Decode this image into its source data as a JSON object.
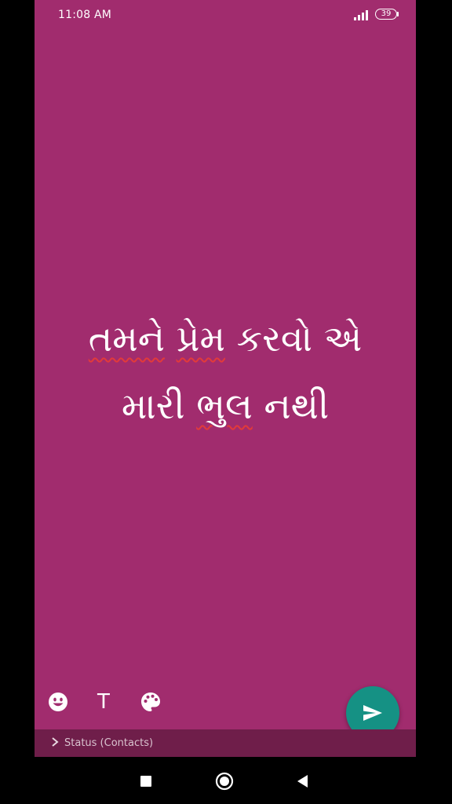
{
  "status_bar": {
    "time": "11:08 AM",
    "battery": "39",
    "icons": [
      "signal-icon",
      "battery-icon"
    ]
  },
  "status_text": {
    "line1_word1": "તમને",
    "line1_word2": "પ્રેમ",
    "line1_word3": "કરવો એ",
    "line2_word1": "મારી",
    "line2_word2": "ભુલ",
    "line2_word3": "નથી"
  },
  "tools": {
    "text_tool_label": "T",
    "icons": [
      "emoji-icon",
      "palette-icon"
    ]
  },
  "send_button": {
    "icon": "send-icon"
  },
  "audience": {
    "label": "Status (Contacts)"
  },
  "navigation": {
    "icons": [
      "recents-icon",
      "home-icon",
      "back-icon"
    ]
  },
  "colors": {
    "background": "#a12c6e",
    "send_button": "#159184",
    "audience_bar": "#6f1e4a",
    "spellcheck_underline": "#e23a3a"
  }
}
